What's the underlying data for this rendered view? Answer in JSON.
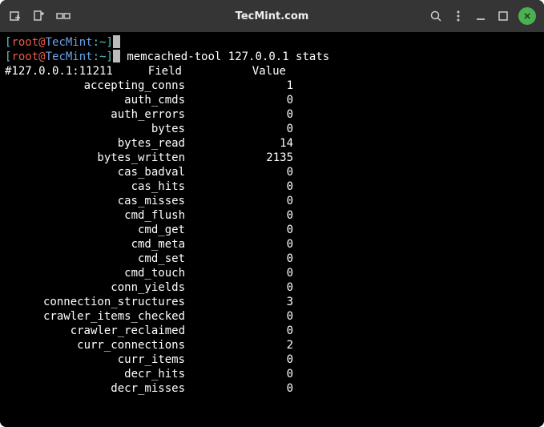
{
  "window": {
    "title": "TecMint.com"
  },
  "prompt": {
    "line1": {
      "br_open": "[",
      "user": "root",
      "at": "@",
      "host": "TecMint",
      "path": ":~",
      "br_close": "]"
    },
    "line2": {
      "br_open": "[",
      "user": "root",
      "at": "@",
      "host": "TecMint",
      "path": ":~",
      "br_close": "]",
      "command": "memcached-tool 127.0.0.1 stats"
    },
    "header": {
      "host": "#127.0.0.1:11211",
      "field": "Field",
      "value": "Value"
    }
  },
  "stats": [
    {
      "field": "accepting_conns",
      "value": "1"
    },
    {
      "field": "auth_cmds",
      "value": "0"
    },
    {
      "field": "auth_errors",
      "value": "0"
    },
    {
      "field": "bytes",
      "value": "0"
    },
    {
      "field": "bytes_read",
      "value": "14"
    },
    {
      "field": "bytes_written",
      "value": "2135"
    },
    {
      "field": "cas_badval",
      "value": "0"
    },
    {
      "field": "cas_hits",
      "value": "0"
    },
    {
      "field": "cas_misses",
      "value": "0"
    },
    {
      "field": "cmd_flush",
      "value": "0"
    },
    {
      "field": "cmd_get",
      "value": "0"
    },
    {
      "field": "cmd_meta",
      "value": "0"
    },
    {
      "field": "cmd_set",
      "value": "0"
    },
    {
      "field": "cmd_touch",
      "value": "0"
    },
    {
      "field": "conn_yields",
      "value": "0"
    },
    {
      "field": "connection_structures",
      "value": "3"
    },
    {
      "field": "crawler_items_checked",
      "value": "0"
    },
    {
      "field": "crawler_reclaimed",
      "value": "0"
    },
    {
      "field": "curr_connections",
      "value": "2"
    },
    {
      "field": "curr_items",
      "value": "0"
    },
    {
      "field": "decr_hits",
      "value": "0"
    },
    {
      "field": "decr_misses",
      "value": "0"
    }
  ]
}
